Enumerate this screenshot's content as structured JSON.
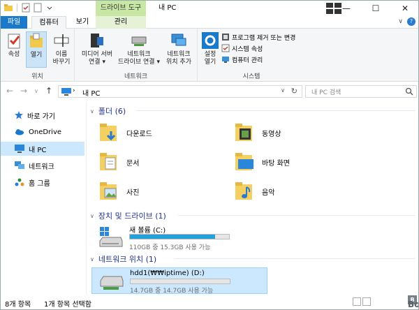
{
  "window": {
    "title": "내 PC",
    "context_tab_header": "드라이브 도구"
  },
  "tabs": {
    "file": "파일",
    "computer": "컴퓨터",
    "view": "보기",
    "manage": "관리"
  },
  "ribbon": {
    "location_group": {
      "label": "위치",
      "properties": "속성",
      "open": "열기",
      "rename_1": "이름",
      "rename_2": "바꾸기"
    },
    "network_group": {
      "label": "네트워크",
      "media_1": "미디어 서버",
      "media_2": "연결",
      "map_1": "네트워크",
      "map_2": "드라이브 연결",
      "add_1": "네트워크",
      "add_2": "위치 추가"
    },
    "system_group": {
      "label": "시스템",
      "settings_1": "설정",
      "settings_2": "열기",
      "uninstall": "프로그램 제거 또는 변경",
      "sys_props": "시스템 속성",
      "manage": "컴퓨터 관리"
    }
  },
  "address": {
    "path": "내 PC",
    "search_placeholder": "내 PC 검색"
  },
  "nav": {
    "items": [
      "바로 가기",
      "OneDrive",
      "내 PC",
      "네트워크",
      "홈 그룹"
    ]
  },
  "content": {
    "folders_header": "폴더 (6)",
    "folders": [
      "다운로드",
      "동영상",
      "문서",
      "바탕 화면",
      "사진",
      "음악"
    ],
    "drives_header": "장치 및 드라이브 (1)",
    "drive": {
      "name": "새 볼륨 (C:)",
      "free": "110GB 중 15.3GB 사용 가능",
      "used_fraction": 0.86
    },
    "network_header": "네트워크 위치 (1)",
    "netdrive": {
      "name": "hdd1(₩₩iptime) (D:)",
      "free": "14.7GB 중 14.7GB 사용 가능",
      "used_fraction": 0.0
    }
  },
  "status": {
    "items": "8개 항목",
    "selected": "1개 항목 선택함",
    "watermark": "BodNara"
  },
  "colors": {
    "accent": "#1979ca",
    "selected_bg": "#cce8ff",
    "drive_bar": "#26a0da",
    "context_tab": "#c8e6a4"
  }
}
